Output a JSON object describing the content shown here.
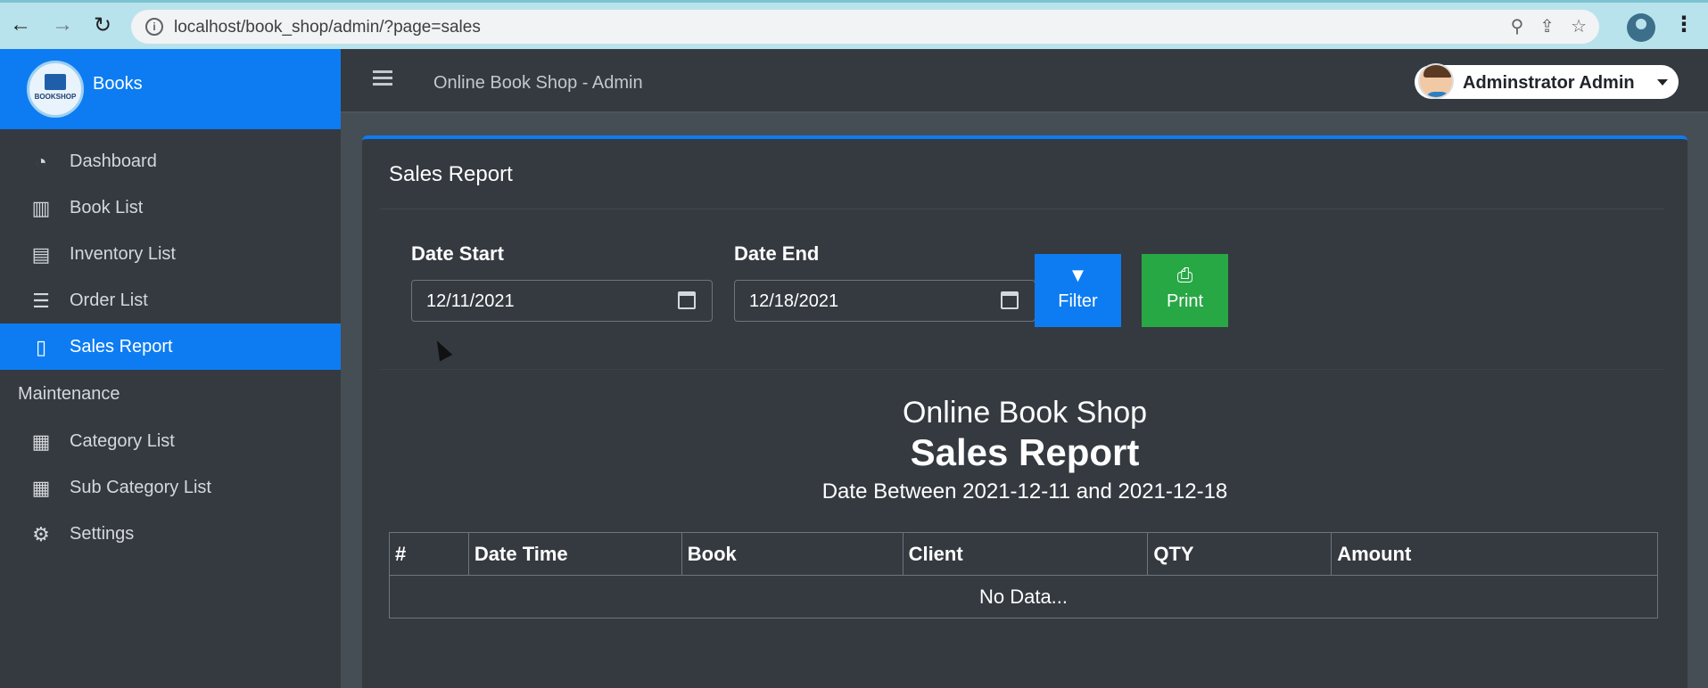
{
  "browser": {
    "url": "localhost/book_shop/admin/?page=sales",
    "back_icon": "←",
    "forward_icon": "→",
    "reload_icon": "↻",
    "info_icon": "i",
    "zoom_icon": "⚲",
    "share_icon": "⇪",
    "star_icon": "☆",
    "menu_icon": "⋮"
  },
  "sidebar": {
    "brand_name": "Books",
    "logo_text": "BOOKSHOP",
    "items": [
      {
        "label": "Dashboard",
        "icon": "◔"
      },
      {
        "label": "Book List",
        "icon": "▥"
      },
      {
        "label": "Inventory List",
        "icon": "▤"
      },
      {
        "label": "Order List",
        "icon": "☰"
      },
      {
        "label": "Sales Report",
        "icon": "▯"
      }
    ],
    "maintenance_header": "Maintenance",
    "maintenance_items": [
      {
        "label": "Category List",
        "icon": "▦"
      },
      {
        "label": "Sub Category List",
        "icon": "▦"
      },
      {
        "label": "Settings",
        "icon": "⚙"
      }
    ]
  },
  "topbar": {
    "title": "Online Book Shop - Admin",
    "user_name": "Adminstrator Admin"
  },
  "card": {
    "title": "Sales Report"
  },
  "filters": {
    "date_start_label": "Date Start",
    "date_start_value": "12/11/2021",
    "date_end_label": "Date End",
    "date_end_value": "12/18/2021",
    "filter_label": "Filter",
    "filter_icon": "▼",
    "print_label": "Print",
    "print_icon": "⎙"
  },
  "report": {
    "shop_name": "Online Book Shop",
    "title": "Sales Report",
    "range": "Date Between 2021-12-11 and 2021-12-18"
  },
  "table": {
    "headers": [
      "#",
      "Date Time",
      "Book",
      "Client",
      "QTY",
      "Amount"
    ],
    "empty_text": "No Data..."
  },
  "colors": {
    "primary": "#0d7cf2",
    "success": "#28a745",
    "sidebar_bg": "#343a40"
  }
}
